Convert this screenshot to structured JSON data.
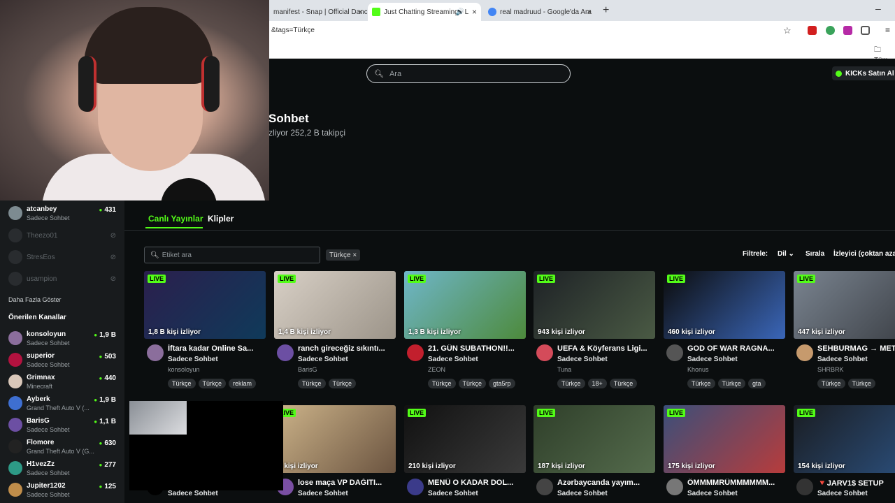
{
  "browser": {
    "tabs": [
      {
        "title": "manifest - Snap | Official Dance",
        "active": false
      },
      {
        "title": "Just Chatting Streaming - L",
        "active": true
      },
      {
        "title": "real madruud - Google'da Ara",
        "active": false
      }
    ],
    "url": "&tags=Türkçe",
    "bookmark_folder": "Tüm"
  },
  "header": {
    "search_placeholder": "Ara",
    "kicks_button": "KICKs Satın Al",
    "accent": "#53fc18"
  },
  "category": {
    "title": "Sohbet",
    "subtitle": "zliyor  252,2 B takipçi"
  },
  "sidebar": {
    "followed": [
      {
        "name": "atcanbey",
        "category": "Sadece Sohbet",
        "viewers": "431",
        "online": true,
        "color": "#7d8b91"
      },
      {
        "name": "Theezo01",
        "online": false
      },
      {
        "name": "StresEos",
        "online": false
      },
      {
        "name": "usampion",
        "online": false
      }
    ],
    "show_more": "Daha Fazla Göster",
    "recommended_title": "Önerilen Kanallar",
    "recommended": [
      {
        "name": "konsoloyun",
        "category": "Sadece Sohbet",
        "viewers": "1,9 B",
        "color": "#8b6e9c"
      },
      {
        "name": "superior",
        "category": "Sadece Sohbet",
        "viewers": "503",
        "color": "#b3123f"
      },
      {
        "name": "Grimnax",
        "category": "Minecraft",
        "viewers": "440",
        "color": "#d9c7b9"
      },
      {
        "name": "Ayberk",
        "category": "Grand Theft Auto V (...",
        "viewers": "1,9 B",
        "color": "#3e6fd1"
      },
      {
        "name": "BarisG",
        "category": "Sadece Sohbet",
        "viewers": "1,1 B",
        "color": "#6c4fa3"
      },
      {
        "name": "Flomore",
        "category": "Grand Theft Auto V (G...",
        "viewers": "630",
        "color": "#222"
      },
      {
        "name": "H1vezZz",
        "category": "Sadece Sohbet",
        "viewers": "277",
        "color": "#2d9a86"
      },
      {
        "name": "Jupiter1202",
        "category": "Sadece Sohbet",
        "viewers": "125",
        "color": "#c08d4a"
      }
    ]
  },
  "tabs": {
    "live": "Canlı Yayınlar",
    "clips": "Klipler"
  },
  "filters": {
    "tag_placeholder": "Etiket ara",
    "active_tag": "Türkçe ×",
    "filter_label": "Filtrele:",
    "language": "Dil ⌄",
    "sort_label": "Sırala",
    "sort_value": "İzleyici (çoktan aza"
  },
  "live_badge": "LIVE",
  "streams_row1": [
    {
      "viewers": "1,8 B kişi izliyor",
      "title": "İftara kadar Online Sa...",
      "category": "Sadece Sohbet",
      "streamer": "konsoloyun",
      "tags": [
        "Türkçe",
        "Türkçe",
        "reklam"
      ],
      "thumb": "#2b1f4d",
      "thumb2": "#0f3a5a",
      "avatar": "#8b6e9c"
    },
    {
      "viewers": "1,4 B kişi izliyor",
      "title": "ranch gireceğiz sıkıntı...",
      "category": "Sadece Sohbet",
      "streamer": "BarisG",
      "tags": [
        "Türkçe",
        "Türkçe"
      ],
      "thumb": "#d8d0c6",
      "thumb2": "#9c9489",
      "avatar": "#6c4fa3"
    },
    {
      "viewers": "1,3 B kişi izliyor",
      "title": "21. GÜN SUBATHON!!...",
      "category": "Sadece Sohbet",
      "streamer": "ZEON",
      "tags": [
        "Türkçe",
        "Türkçe",
        "gta5rp"
      ],
      "thumb": "#6fb6c9",
      "thumb2": "#4d8a3c",
      "avatar": "#c21f2d"
    },
    {
      "viewers": "943 kişi izliyor",
      "title": "UEFA & Köyferans Ligi...",
      "category": "Sadece Sohbet",
      "streamer": "Tuna",
      "tags": [
        "Türkçe",
        "18+",
        "Türkçe"
      ],
      "thumb": "#1e2226",
      "thumb2": "#4a5a44",
      "avatar": "#d44b5a"
    },
    {
      "viewers": "460 kişi izliyor",
      "title": "GOD OF WAR RAGNA...",
      "category": "Sadece Sohbet",
      "streamer": "Khonus",
      "tags": [
        "Türkçe",
        "Türkçe",
        "gta"
      ],
      "thumb": "#0c0c0c",
      "thumb2": "#3a66b8",
      "avatar": "#555"
    },
    {
      "viewers": "447 kişi izliyor",
      "title": "SEHBURMAG → MET",
      "category": "Sadece Sohbet",
      "streamer": "SHRBRK",
      "tags": [
        "Türkçe",
        "Türkçe"
      ],
      "thumb": "#7a8490",
      "thumb2": "#3b3f45",
      "avatar": "#c69a6d"
    }
  ],
  "streams_row2": [
    {
      "viewers": "",
      "title": "",
      "category": "Sadece Sohbet",
      "streamer": "",
      "tags": [],
      "thumb": "#000",
      "thumb2": "#000",
      "avatar": "#000"
    },
    {
      "viewers": "4 kişi izliyor",
      "title": "lose maça VP DAĞITI...",
      "category": "Sadece Sohbet",
      "streamer": "",
      "tags": [],
      "thumb": "#cdb48a",
      "thumb2": "#6b5440",
      "avatar": "#7a4fa3"
    },
    {
      "viewers": "210 kişi izliyor",
      "title": "MENÜ O KADAR DOL...",
      "category": "Sadece Sohbet",
      "streamer": "",
      "tags": [],
      "thumb": "#111",
      "thumb2": "#3a3a3a",
      "avatar": "#3b3b8a"
    },
    {
      "viewers": "187 kişi izliyor",
      "title": "Azərbaycanda yayım...",
      "category": "Sadece Sohbet",
      "streamer": "",
      "tags": [],
      "thumb": "#2f3f2a",
      "thumb2": "#546b4c",
      "avatar": "#444"
    },
    {
      "viewers": "175 kişi izliyor",
      "title": "ÖMMMMRÜMMMMMM...",
      "category": "Sadece Sohbet",
      "streamer": "",
      "tags": [],
      "thumb": "#3b4f7a",
      "thumb2": "#b73c3c",
      "avatar": "#777"
    },
    {
      "viewers": "154 kişi izliyor",
      "title": "🔻JARV1$ SETUP",
      "category": "Sadece Sohbet",
      "streamer": "",
      "tags": [],
      "thumb": "#1a1d22",
      "thumb2": "#2b4f7c",
      "avatar": "#333"
    }
  ]
}
